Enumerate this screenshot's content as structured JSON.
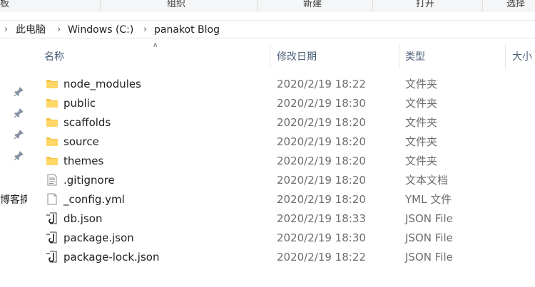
{
  "ribbon": {
    "groups": [
      "板",
      "组织",
      "新建",
      "打开",
      "选择"
    ]
  },
  "address": {
    "crumbs": [
      "此电脑",
      "Windows (C:)",
      "panakot Blog"
    ]
  },
  "nav": {
    "partial_label": "博客摘"
  },
  "columns": {
    "name": "名称",
    "date": "修改日期",
    "type": "类型",
    "size": "大小"
  },
  "files": [
    {
      "name": "node_modules",
      "date": "2020/2/19 18:22",
      "type": "文件夹",
      "icon": "folder-icon"
    },
    {
      "name": "public",
      "date": "2020/2/19 18:30",
      "type": "文件夹",
      "icon": "folder-icon"
    },
    {
      "name": "scaffolds",
      "date": "2020/2/19 18:20",
      "type": "文件夹",
      "icon": "folder-icon"
    },
    {
      "name": "source",
      "date": "2020/2/19 18:20",
      "type": "文件夹",
      "icon": "folder-icon"
    },
    {
      "name": "themes",
      "date": "2020/2/19 18:20",
      "type": "文件夹",
      "icon": "folder-icon"
    },
    {
      "name": ".gitignore",
      "date": "2020/2/19 18:20",
      "type": "文本文档",
      "icon": "text-file-icon"
    },
    {
      "name": "_config.yml",
      "date": "2020/2/19 18:20",
      "type": "YML 文件",
      "icon": "blank-file-icon"
    },
    {
      "name": "db.json",
      "date": "2020/2/19 18:33",
      "type": "JSON File",
      "icon": "json-file-icon"
    },
    {
      "name": "package.json",
      "date": "2020/2/19 18:30",
      "type": "JSON File",
      "icon": "json-file-icon"
    },
    {
      "name": "package-lock.json",
      "date": "2020/2/19 18:22",
      "type": "JSON File",
      "icon": "json-file-icon"
    }
  ],
  "colors": {
    "folder": "#f6c442",
    "header_text": "#4c607a",
    "secondary_text": "#6d6d6d"
  }
}
